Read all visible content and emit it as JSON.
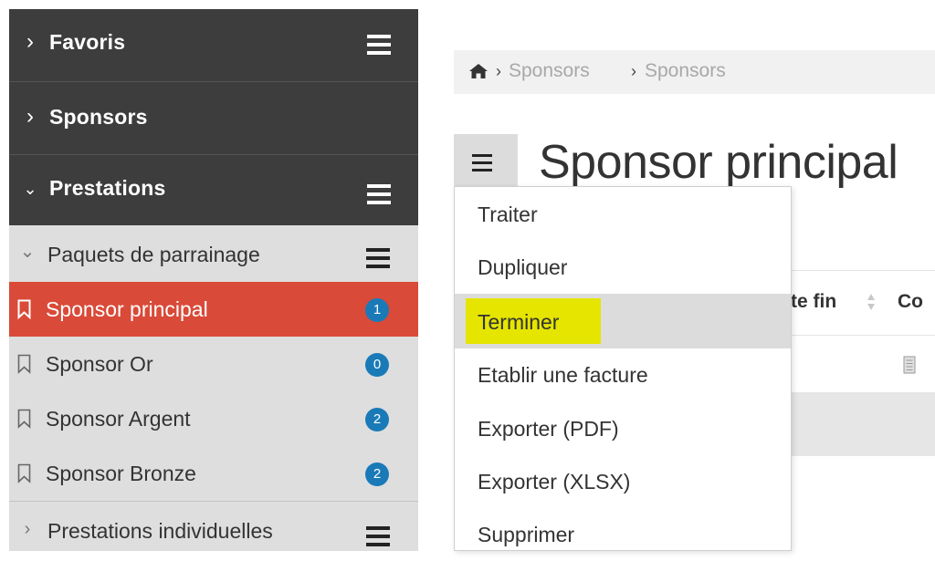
{
  "sidebar": {
    "sections": [
      {
        "label": "Favoris",
        "expanded": false,
        "icon": "chevron-right-icon"
      },
      {
        "label": "Sponsors",
        "expanded": false,
        "icon": "chevron-right-icon"
      },
      {
        "label": "Prestations",
        "expanded": true,
        "icon": "chevron-down-icon"
      }
    ],
    "group": {
      "label": "Paquets de parrainage",
      "expanded": true
    },
    "items": [
      {
        "label": "Sponsor principal",
        "count": "1",
        "active": true
      },
      {
        "label": "Sponsor Or",
        "count": "0",
        "active": false
      },
      {
        "label": "Sponsor Argent",
        "count": "2",
        "active": false
      },
      {
        "label": "Sponsor Bronze",
        "count": "2",
        "active": false
      }
    ],
    "group2": {
      "label": "Prestations individuelles",
      "expanded": false
    }
  },
  "breadcrumb": {
    "items": [
      "Sponsors",
      "Sponsors"
    ]
  },
  "page": {
    "title": "Sponsor principal"
  },
  "table": {
    "headers": [
      "te fin",
      "Co"
    ]
  },
  "dropdown": {
    "items": [
      "Traiter",
      "Dupliquer",
      "Terminer",
      "Etablir une facture",
      "Exporter (PDF)",
      "Exporter (XLSX)",
      "Supprimer"
    ],
    "hovered": "Terminer"
  },
  "colors": {
    "sidebar_dark": "#3d3d3d",
    "sidebar_light": "#dedede",
    "active_item": "#d94a38",
    "badge": "#1a7ab8",
    "highlight": "#e5e500"
  }
}
